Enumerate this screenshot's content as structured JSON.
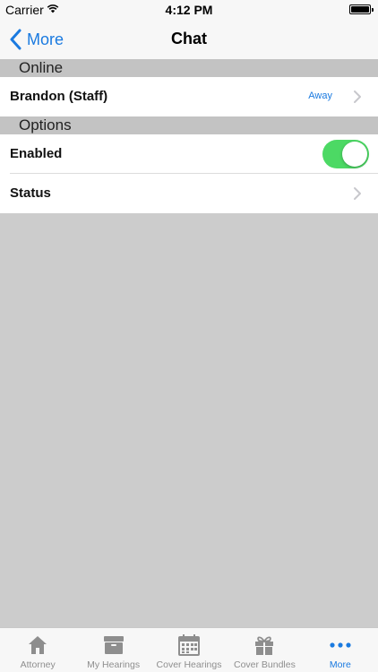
{
  "status_bar": {
    "carrier": "Carrier",
    "time": "4:12 PM"
  },
  "nav": {
    "back_label": "More",
    "title": "Chat"
  },
  "sections": {
    "online": {
      "header": "Online",
      "rows": [
        {
          "label": "Brandon (Staff)",
          "detail": "Away"
        }
      ]
    },
    "options": {
      "header": "Options",
      "rows": [
        {
          "label": "Enabled",
          "toggle_on": true
        },
        {
          "label": "Status"
        }
      ]
    }
  },
  "tabbar": {
    "items": [
      {
        "label": "Attorney",
        "icon": "house-icon"
      },
      {
        "label": "My Hearings",
        "icon": "archive-box-icon"
      },
      {
        "label": "Cover Hearings",
        "icon": "calendar-icon"
      },
      {
        "label": "Cover Bundles",
        "icon": "gift-icon"
      },
      {
        "label": "More",
        "icon": "more-dots-icon"
      }
    ],
    "active_index": 4
  },
  "colors": {
    "accent": "#1a7ae0",
    "toggle_on": "#4cd964",
    "section_header_bg": "#c3c3c3",
    "background": "#cccccc"
  }
}
